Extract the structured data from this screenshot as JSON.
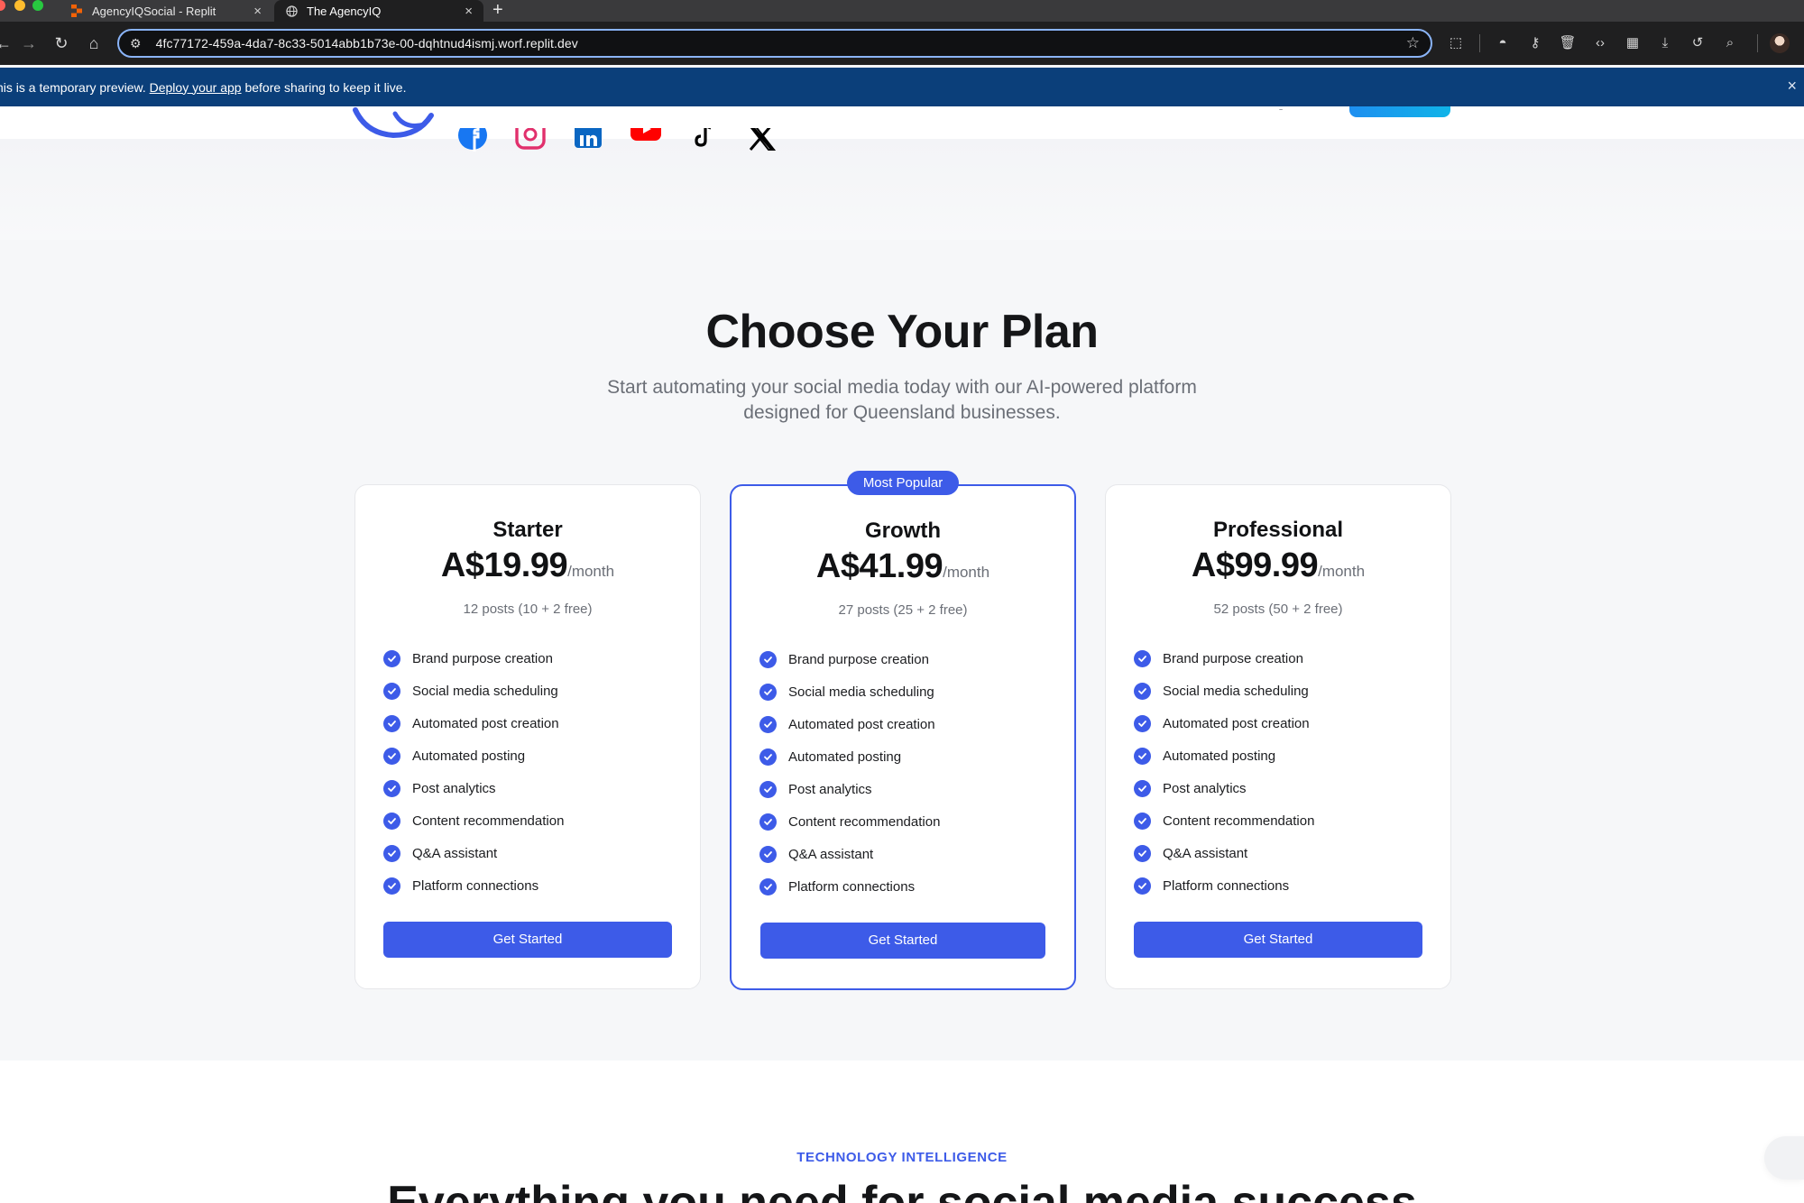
{
  "browser": {
    "tabs": [
      {
        "title": "AgencyIQSocial - Replit",
        "active": false,
        "icon": "replit-icon"
      },
      {
        "title": "The AgencyIQ",
        "active": true,
        "icon": "globe-icon"
      }
    ],
    "new_tab_symbol": "+",
    "close_symbol": "×",
    "url": "4fc77172-459a-4da7-8c33-5014abb1b73e-00-dqhtnud4ismj.worf.replit.dev",
    "toolbar_icons": [
      "back-icon",
      "forward-icon",
      "reload-icon",
      "home-icon",
      "site-settings-icon",
      "bookmark-star-icon",
      "extensions-icon",
      "incognito-icon",
      "password-key-icon",
      "trash-icon",
      "code-icon",
      "sidebar-icon",
      "download-icon",
      "history-icon",
      "search-tab-icon",
      "profile-avatar"
    ]
  },
  "banner": {
    "text_before": "his is a temporary preview. ",
    "link": "Deploy your app",
    "text_after": " before sharing to keep it live.",
    "bg": "#0b3f7a"
  },
  "social_icons": [
    "facebook-icon",
    "instagram-icon",
    "linkedin-icon",
    "youtube-icon",
    "tiktok-icon",
    "x-icon"
  ],
  "pricing": {
    "title": "Choose Your Plan",
    "subtitle": "Start automating your social media today with our AI-powered platform designed for Queensland businesses.",
    "accent": "#3d5be8",
    "plans": [
      {
        "name": "Starter",
        "price": "A$19.99",
        "period": "/month",
        "posts": "12 posts (10 + 2 free)",
        "badge": "",
        "cta": "Get Started",
        "features": [
          "Brand purpose creation",
          "Social media scheduling",
          "Automated post creation",
          "Automated posting",
          "Post analytics",
          "Content recommendation",
          "Q&A assistant",
          "Platform connections"
        ]
      },
      {
        "name": "Growth",
        "price": "A$41.99",
        "period": "/month",
        "posts": "27 posts (25 + 2 free)",
        "badge": "Most Popular",
        "cta": "Get Started",
        "features": [
          "Brand purpose creation",
          "Social media scheduling",
          "Automated post creation",
          "Automated posting",
          "Post analytics",
          "Content recommendation",
          "Q&A assistant",
          "Platform connections"
        ]
      },
      {
        "name": "Professional",
        "price": "A$99.99",
        "period": "/month",
        "posts": "52 posts (50 + 2 free)",
        "badge": "",
        "cta": "Get Started",
        "features": [
          "Brand purpose creation",
          "Social media scheduling",
          "Automated post creation",
          "Automated posting",
          "Post analytics",
          "Content recommendation",
          "Q&A assistant",
          "Platform connections"
        ]
      }
    ]
  },
  "next_section": {
    "eyebrow": "TECHNOLOGY INTELLIGENCE",
    "title": "Everything you need for social media success"
  }
}
